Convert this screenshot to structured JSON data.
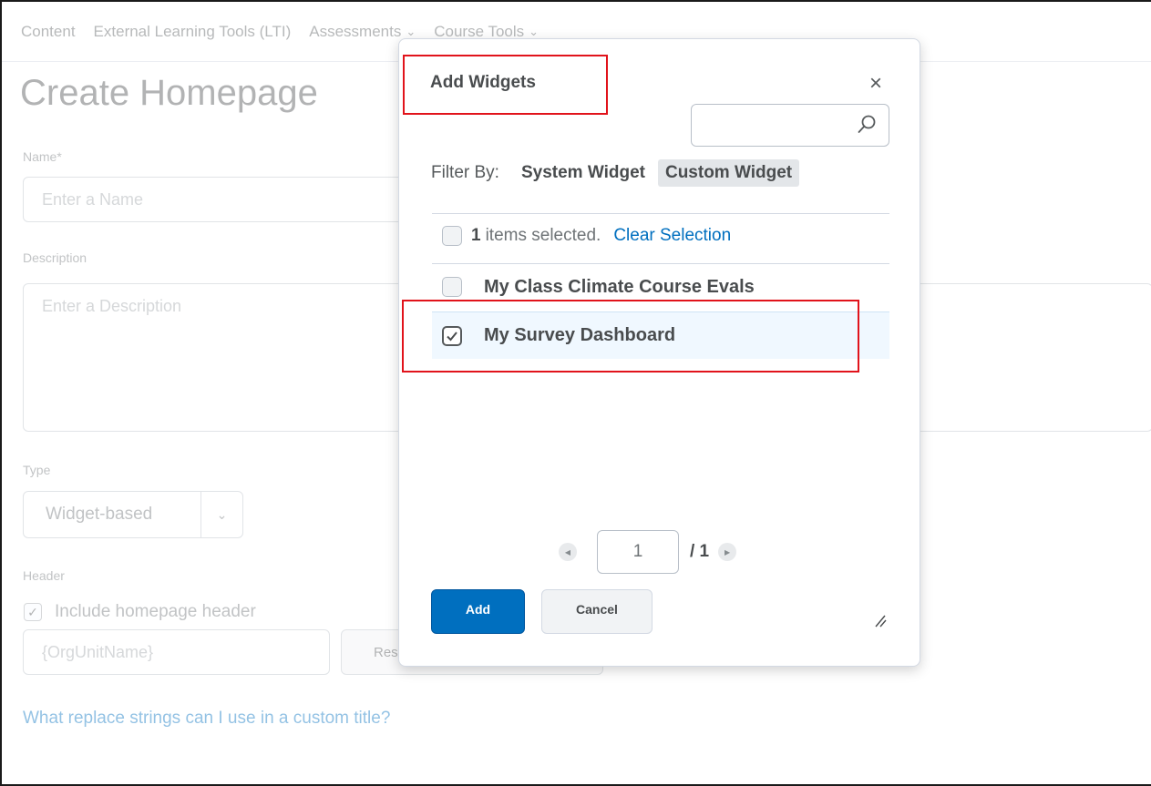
{
  "nav": {
    "items": [
      {
        "label": "Content",
        "has_chevron": false
      },
      {
        "label": "External Learning Tools (LTI)",
        "has_chevron": false
      },
      {
        "label": "Assessments",
        "has_chevron": true
      },
      {
        "label": "Course Tools",
        "has_chevron": true
      }
    ]
  },
  "page": {
    "title": "Create Homepage",
    "name_label": "Name*",
    "name_placeholder": "Enter a Name",
    "description_label": "Description",
    "description_placeholder": "Enter a Description",
    "type_label": "Type",
    "type_value": "Widget-based",
    "header_label": "Header",
    "include_header_label": "Include homepage header",
    "header_value": "{OrgUnitName}",
    "reset_button_label": "Res",
    "help_link": "What replace strings can I use in a custom title?"
  },
  "dialog": {
    "title": "Add Widgets",
    "close_glyph": "×",
    "search_value": "",
    "filter_label": "Filter By:",
    "filters": [
      {
        "label": "System Widget",
        "active": false
      },
      {
        "label": "Custom Widget",
        "active": true
      }
    ],
    "selection": {
      "count": "1",
      "text": "items selected.",
      "clear_label": "Clear Selection"
    },
    "items": [
      {
        "label": "My Class Climate Course Evals",
        "checked": false
      },
      {
        "label": "My Survey Dashboard",
        "checked": true
      }
    ],
    "pagination": {
      "current_page": "1",
      "total": "/ 1"
    },
    "add_label": "Add",
    "cancel_label": "Cancel"
  },
  "colors": {
    "primary": "#006fbf",
    "annotation": "#e1131b",
    "link": "#006fbf"
  }
}
